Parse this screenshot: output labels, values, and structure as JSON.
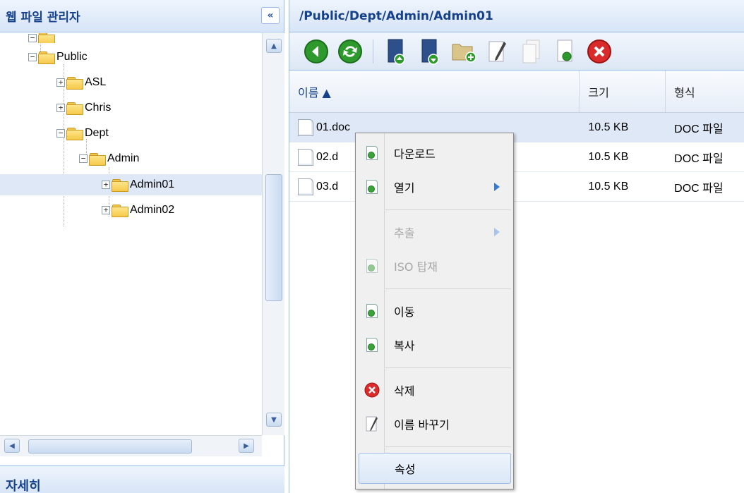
{
  "left_panel": {
    "title": "웹 파일 관리자",
    "collapse_label": "«",
    "tree": [
      {
        "label": "Public"
      },
      {
        "label": "ASL"
      },
      {
        "label": "Chris"
      },
      {
        "label": "Dept"
      },
      {
        "label": "Admin"
      },
      {
        "label": "Admin01"
      },
      {
        "label": "Admin02"
      }
    ],
    "details_title": "자세히"
  },
  "right_panel": {
    "path": "/Public/Dept/Admin/Admin01",
    "columns": {
      "name": "이름 ▲",
      "size": "크기",
      "type": "형식"
    },
    "files": [
      {
        "name": "01.doc",
        "size": "10.5 KB",
        "type": "DOC 파일"
      },
      {
        "name": "02.d",
        "size": "10.5 KB",
        "type": "DOC 파일"
      },
      {
        "name": "03.d",
        "size": "10.5 KB",
        "type": "DOC 파일"
      }
    ]
  },
  "context_menu": {
    "download": "다운로드",
    "open": "열기",
    "extract": "추출",
    "iso_mount": "ISO 탑재",
    "move": "이동",
    "copy": "복사",
    "delete": "삭제",
    "rename": "이름 바꾸기",
    "properties": "속성"
  }
}
